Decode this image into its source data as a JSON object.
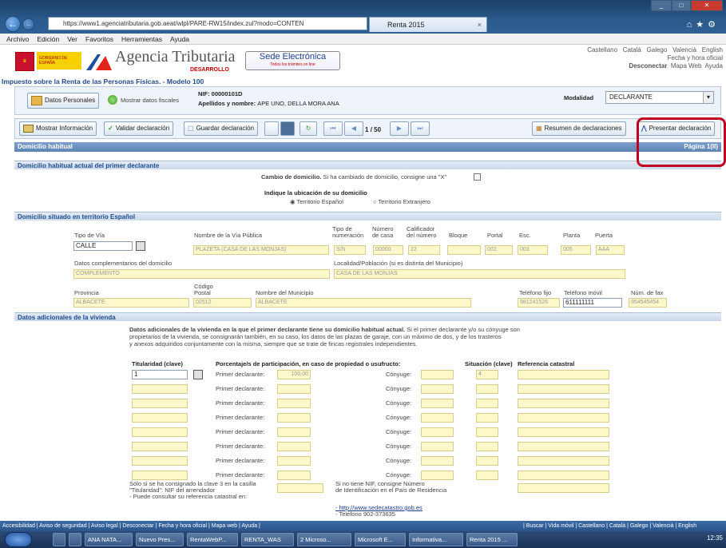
{
  "browser": {
    "url": "https://www1.agenciatributaria.gob.aeat/wlpl/PARE-RW15/index.zul?modo=CONTEN",
    "tab_title": "Renta 2015",
    "close": "×"
  },
  "menu": [
    "Archivo",
    "Edición",
    "Ver",
    "Favoritos",
    "Herramientas",
    "Ayuda"
  ],
  "header": {
    "gobierno": "GOBIERNO DE ESPAÑA",
    "brand": "Agencia Tributaria",
    "desarrollo": "DESARROLLO",
    "sede_title": "Sede Electrónica",
    "sede_sub": "Todos los trámites on line",
    "langs": [
      "Castellano",
      "Català",
      "Galego",
      "Valencià",
      "English"
    ],
    "fecha": "Fecha y hora oficial",
    "links": [
      "Desconectar",
      "Mapa Web",
      "Ayuda"
    ]
  },
  "page_title": "Impuesto sobre la Renta de las Personas Físicas. - Modelo 100",
  "pbar": {
    "datos_personales": "Datos Personales",
    "mostrar_fiscales": "Mostrar datos fiscales",
    "nif": "NIF: 00000101D",
    "nombre_label": "Apellidos y nombre:",
    "nombre": "APE UNO, DELLA MORA ANA",
    "modalidad_label": "Modalidad",
    "modalidad": "DECLARANTE"
  },
  "toolbar": {
    "mostrar": "Mostrar Información",
    "validar": "Validar declaración",
    "guardar": "Guardar declaración",
    "page": "1",
    "total": "/ 50",
    "resumen": "Resumen de declaraciones",
    "presentar": "Presentar declaración"
  },
  "form": {
    "title": "Domicilio habitual",
    "pagina": "Página 1(II)",
    "sec1": "Domicilio habitual actual del primer declarante",
    "cambio_bold": "Cambio de domicilio.",
    "cambio": "Si ha cambiado de domicilio, consigne una \"X\"",
    "ubicacion": "Indique la ubicación de su domicilio",
    "esp": "Territorio Español",
    "ext": "Territorio Extranjero",
    "sec2": "Domicilio situado en territorio Español",
    "labels": {
      "tipo_via": "Tipo de Vía",
      "nombre_via": "Nombre de la Vía Pública",
      "tipo_num": "Tipo de numeración",
      "numero": "Número de casa",
      "calif": "Calificador del número",
      "bloque": "Bloque",
      "portal": "Portal",
      "esc": "Esc.",
      "planta": "Planta",
      "puerta": "Puerta",
      "datos_comp": "Datos complementarios del domicilio",
      "localidad": "Localidad/Población (si es distinta del Municipio)",
      "provincia": "Provincia",
      "cp": "Código Postal",
      "municipio": "Nombre del Municipio",
      "tfijo": "Teléfono fijo",
      "tmovil": "Teléfono móvil",
      "fax": "Núm. de fax"
    },
    "values": {
      "tipo_via": "CALLE",
      "nombre_via": "PLAZETA (CASA DE LAS MONJAS)",
      "tipo_num": "S/N",
      "numero": "00000",
      "calif": "22",
      "portal": "002",
      "esc": "003",
      "planta": "005",
      "puerta": "AAA",
      "datos_comp": "COMPLEMENTO",
      "localidad": "CASA DE LAS MONJAS",
      "provincia": "ALBACETE",
      "cp": "02512",
      "municipio": "ALBACETE",
      "tfijo": "981241526",
      "tmovil": "611111111",
      "fax": "954545454"
    },
    "sec3": "Datos adicionales de la vivienda",
    "desc_bold": "Datos adicionales de la vivienda en la que el primer declarante tiene su domicilio habitual actual.",
    "desc1": "Si el primer declarante y/o su cónyuge son",
    "desc2": "propietarios de la vivienda, se consignarán también, en su caso, los datos de las plazas de garaje, con un máximo de dos, y de los trasteros",
    "desc3": "y anexos adquiridos conjuntamente con la misma, siempre que se trate de fincas registrales independientes.",
    "titularidad": "Titularidad (clave)",
    "porcentaje": "Porcentaje/s de participación, en caso de propiedad o usufructo:",
    "situacion": "Situación (clave)",
    "referencia": "Referencia catastral",
    "primer": "Primer declarante:",
    "conyuge": "Cónyuge:",
    "tit1": "1",
    "pct1": "100,00",
    "sit1": "4",
    "nif1": "Sólo si se ha consignado la clave 3 en la casilla",
    "nif2": "\"Titularidad\": NIF del arrendador",
    "nif3": "- Puede consultar su referencia catastral en:",
    "sinnif1": "Si no tiene NIF, consigne Número",
    "sinnif2": "de Identificación en el País de Residencia",
    "link": "- http://www.sedecatastro.gob.es",
    "tel": "- Teléfono 902-373635"
  },
  "footer": {
    "left": "Accesibilidad | Aviso de seguridad | Aviso legal | Desconectar | Fecha y hora oficial | Mapa web | Ayuda |",
    "right": "| Buscar | Vida móvil | Castellano | Català | Galego | Valencià | English"
  },
  "taskbar": [
    "ANA NATA...",
    "Nuevo Pres...",
    "RentaWebP...",
    "RENTA_WAS",
    "2 Microso...",
    "Microsoft E...",
    "Informativa...",
    "Renta 2015 ..."
  ],
  "clock": "12:35"
}
